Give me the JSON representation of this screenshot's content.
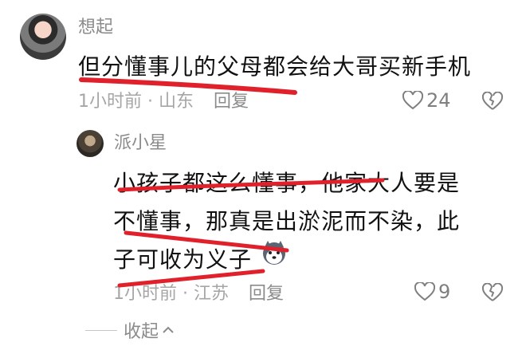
{
  "comments": [
    {
      "username": "想起",
      "text": "但分懂事儿的父母都会给大哥买新手机",
      "time_location": "1小时前 · 山东",
      "reply_label": "回复",
      "like_count": "24"
    },
    {
      "username": "派小星",
      "lines": [
        "小孩子都这么懂事，他家大人要是",
        "不懂事，那真是出淤泥而不染，此",
        "子可收为义子"
      ],
      "time_location": "1小时前 · 江苏",
      "reply_label": "回复",
      "like_count": "9",
      "emoji": "husky-emoji"
    }
  ],
  "collapse_label": "收起",
  "colors": {
    "annotation_red": "#e0202a",
    "text": "#111111",
    "muted": "#8b8b8b"
  }
}
